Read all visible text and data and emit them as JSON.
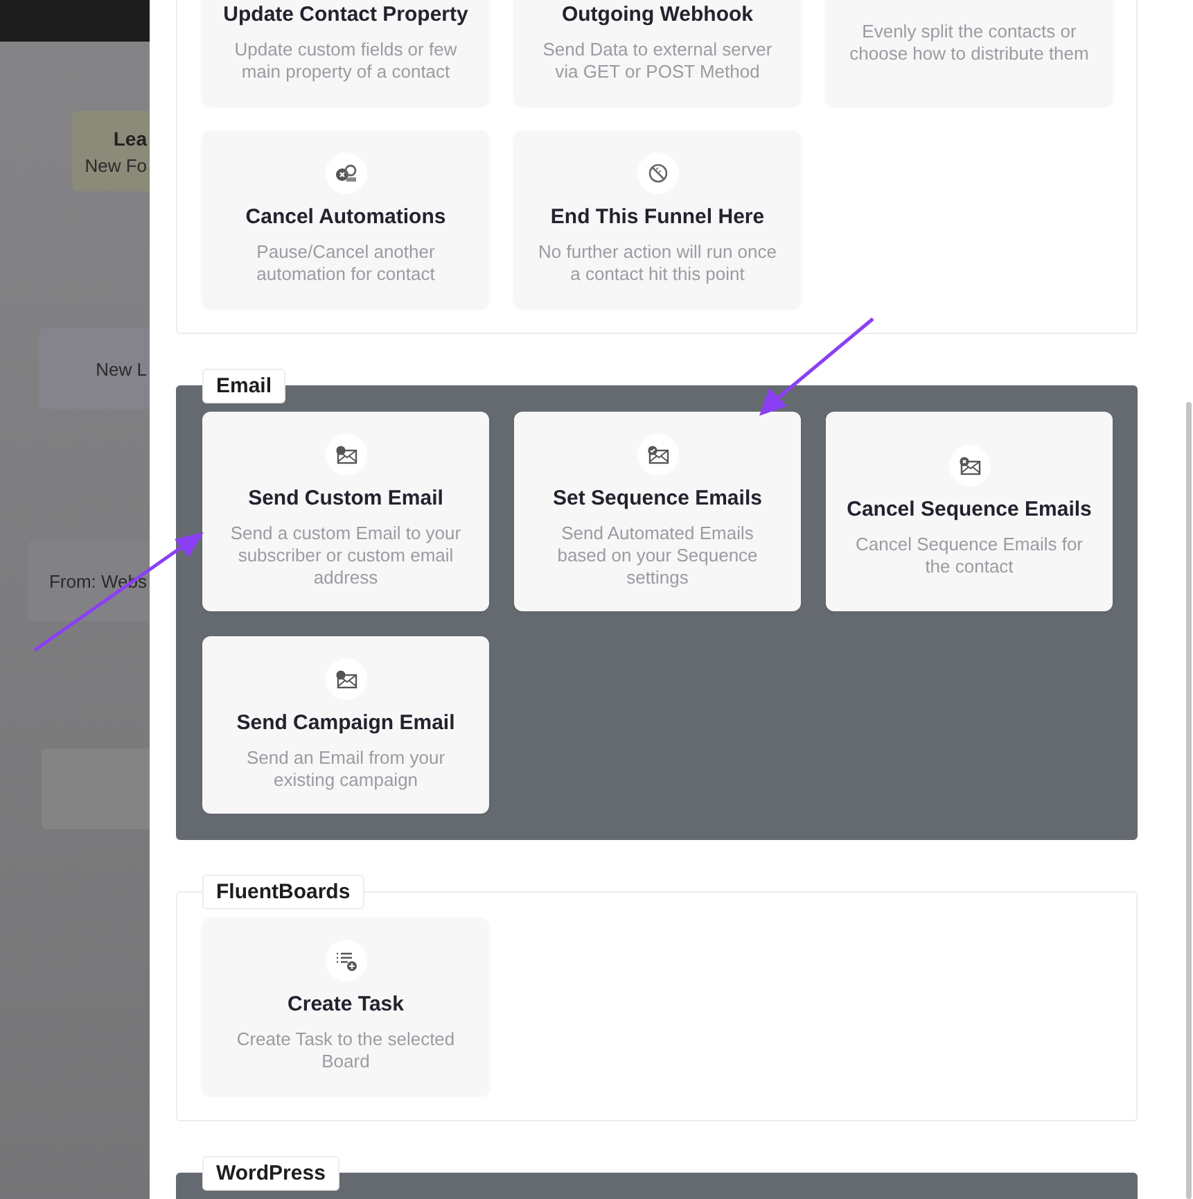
{
  "background": {
    "nodes": [
      {
        "title": "Lea",
        "subtitle": "New Fo",
        "color": "#8c8a78"
      },
      {
        "subtitle": "New L",
        "color": "#85848c"
      },
      {
        "subtitle": "From: Webs",
        "color": "#828286"
      },
      {
        "color": "#848484"
      }
    ]
  },
  "sections": [
    {
      "highlighted": false,
      "cards": [
        {
          "title": "Update Contact Property",
          "description": "Update custom fields or few main property of a contact"
        },
        {
          "title": "Outgoing Webhook",
          "description": "Send Data to external server via GET or POST Method"
        },
        {
          "description": "Evenly split the contacts or choose how to distribute them"
        },
        {
          "kind": "cancel-automation",
          "title": "Cancel Automations",
          "description": "Pause/Cancel another automation for contact"
        },
        {
          "kind": "end-funnel",
          "title": "End This Funnel Here",
          "description": "No further action will run once a contact hit this point"
        }
      ]
    },
    {
      "label": "Email",
      "highlighted": true,
      "cards": [
        {
          "kind": "email",
          "title": "Send Custom Email",
          "description": "Send a custom Email to your subscriber or custom email address"
        },
        {
          "kind": "email-check",
          "title": "Set Sequence Emails",
          "description": "Send Automated Emails based on your Sequence settings"
        },
        {
          "kind": "email-cancel",
          "title": "Cancel Sequence Emails",
          "description": "Cancel Sequence Emails for the contact"
        },
        {
          "kind": "email",
          "title": "Send Campaign Email",
          "description": "Send an Email from your existing campaign"
        }
      ]
    },
    {
      "label": "FluentBoards",
      "highlighted": false,
      "cards": [
        {
          "kind": "task",
          "title": "Create Task",
          "description": "Create Task to the selected Board"
        }
      ]
    },
    {
      "label": "WordPress",
      "highlighted": true
    }
  ]
}
